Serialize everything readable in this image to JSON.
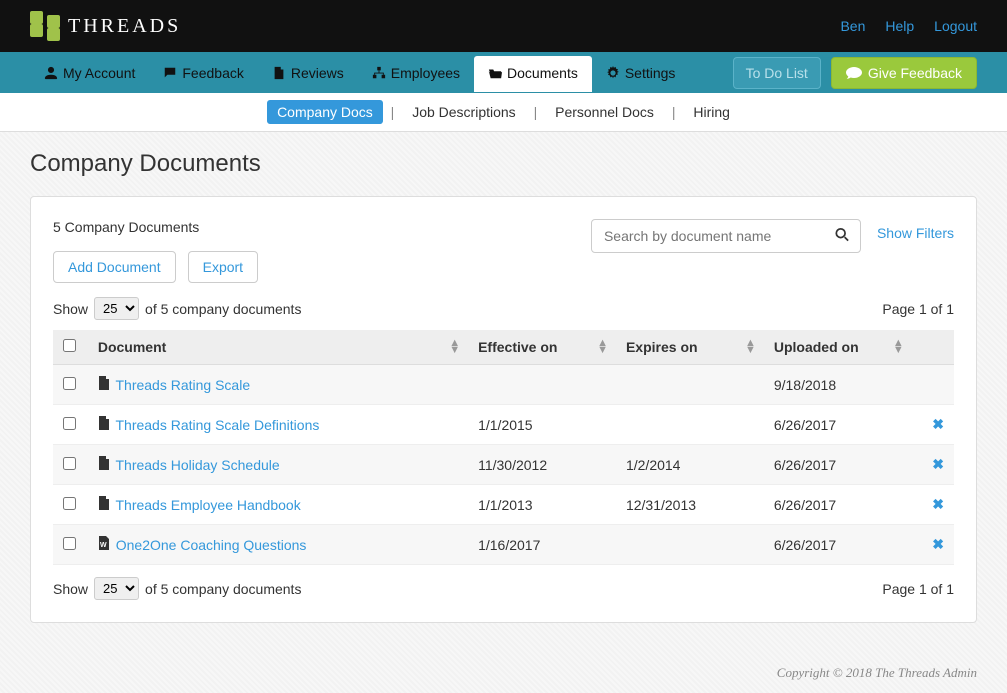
{
  "top": {
    "brand": "THREADS",
    "links": {
      "user": "Ben",
      "help": "Help",
      "logout": "Logout"
    }
  },
  "nav": {
    "account": "My Account",
    "feedback": "Feedback",
    "reviews": "Reviews",
    "employees": "Employees",
    "documents": "Documents",
    "settings": "Settings",
    "todo": "To Do List",
    "give": "Give Feedback"
  },
  "subnav": {
    "company": "Company Docs",
    "jobs": "Job Descriptions",
    "personnel": "Personnel Docs",
    "hiring": "Hiring"
  },
  "page": {
    "title": "Company Documents",
    "count": "5 Company Documents",
    "add": "Add Document",
    "export": "Export",
    "search_placeholder": "Search by document name",
    "show_filters": "Show Filters",
    "show_label_pre": "Show",
    "show_label_post": "of 5 company documents",
    "per_page": "25",
    "page_info": "Page 1 of 1"
  },
  "columns": {
    "document": "Document",
    "effective": "Effective on",
    "expires": "Expires on",
    "uploaded": "Uploaded on"
  },
  "rows": [
    {
      "icon": "pdf",
      "name": "Threads Rating Scale",
      "effective": "",
      "expires": "",
      "uploaded": "9/18/2018",
      "deletable": false
    },
    {
      "icon": "pdf",
      "name": "Threads Rating Scale Definitions",
      "effective": "1/1/2015",
      "expires": "",
      "uploaded": "6/26/2017",
      "deletable": true
    },
    {
      "icon": "pdf",
      "name": "Threads Holiday Schedule",
      "effective": "11/30/2012",
      "expires": "1/2/2014",
      "uploaded": "6/26/2017",
      "deletable": true
    },
    {
      "icon": "pdf",
      "name": "Threads Employee Handbook",
      "effective": "1/1/2013",
      "expires": "12/31/2013",
      "uploaded": "6/26/2017",
      "deletable": true
    },
    {
      "icon": "word",
      "name": "One2One Coaching Questions",
      "effective": "1/16/2017",
      "expires": "",
      "uploaded": "6/26/2017",
      "deletable": true
    }
  ],
  "footer": "Copyright © 2018 The Threads Admin"
}
